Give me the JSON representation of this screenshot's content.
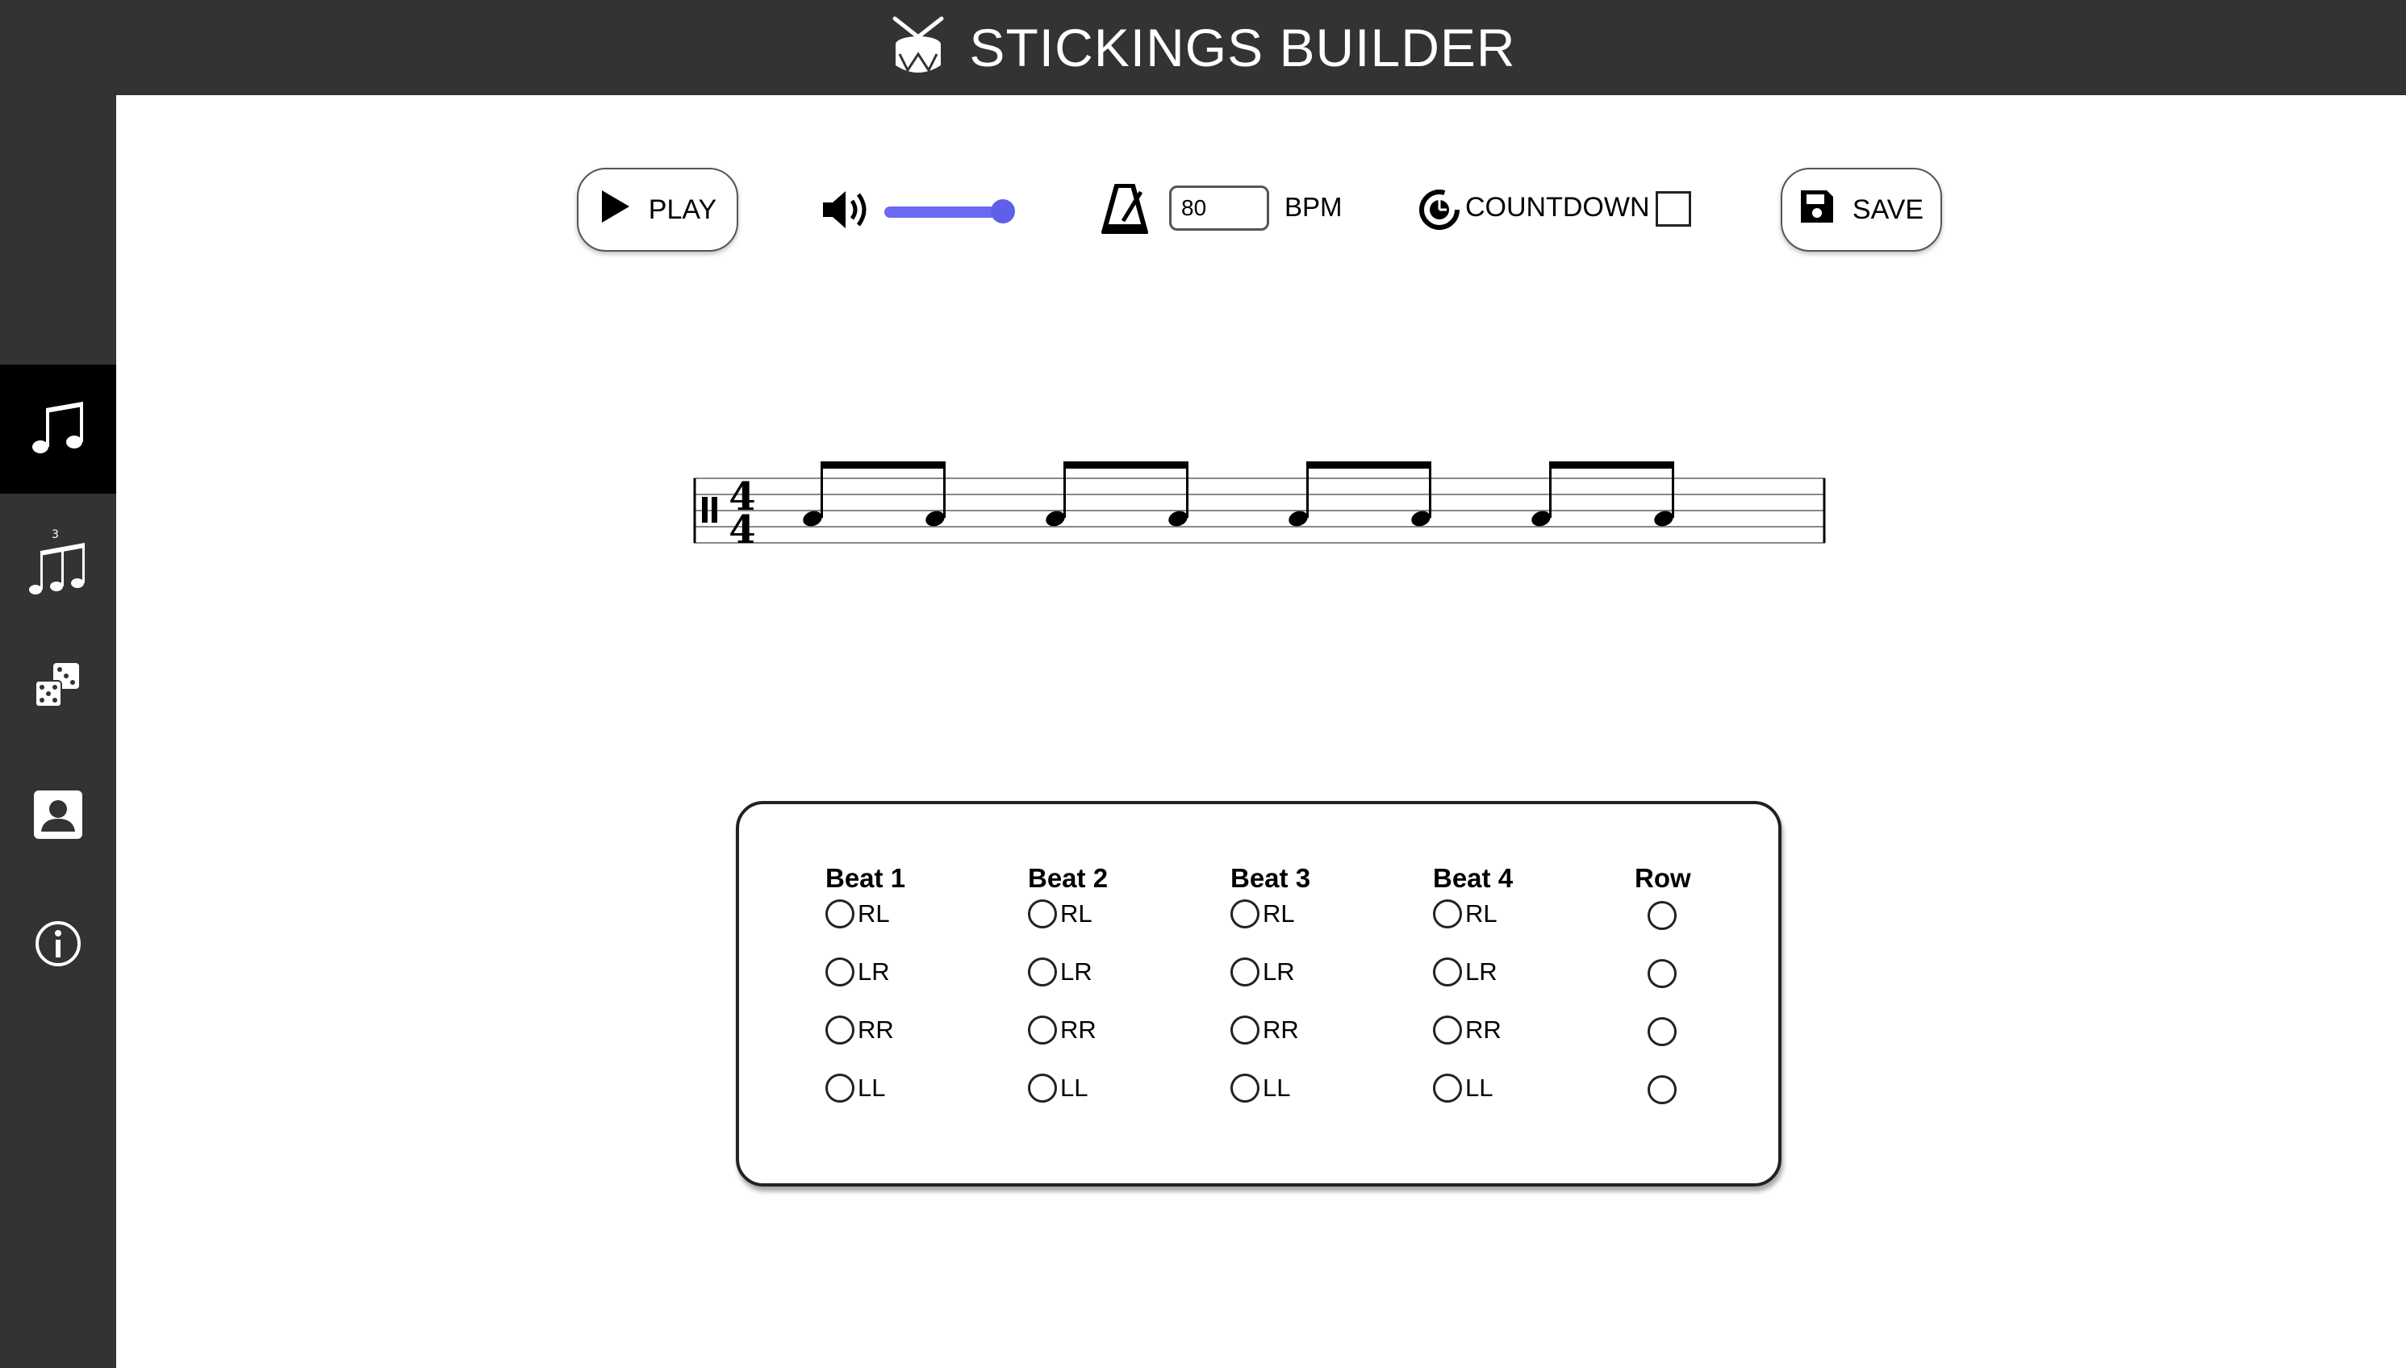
{
  "header": {
    "title": "STICKINGS BUILDER",
    "logo_icon": "drum-icon"
  },
  "sidebar": {
    "items": [
      {
        "icon": "music-note-icon",
        "active": true
      },
      {
        "icon": "triplet-notes-icon",
        "active": false
      },
      {
        "icon": "dice-icon",
        "active": false
      },
      {
        "icon": "contact-card-icon",
        "active": false
      },
      {
        "icon": "info-icon",
        "active": false
      }
    ]
  },
  "toolbar": {
    "play_label": "PLAY",
    "volume_level": 1.0,
    "bpm_value": "80",
    "bpm_label": "BPM",
    "countdown_label": "COUNTDOWN",
    "countdown_checked": false,
    "save_label": "SAVE",
    "accent_color": "#5f5fe8"
  },
  "notation": {
    "time_signature_top": "4",
    "time_signature_bottom": "4",
    "beats": 4,
    "notes_per_beat": 2
  },
  "stickings": {
    "columns": [
      {
        "header": "Beat 1",
        "options": [
          "RL",
          "LR",
          "RR",
          "LL"
        ]
      },
      {
        "header": "Beat 2",
        "options": [
          "RL",
          "LR",
          "RR",
          "LL"
        ]
      },
      {
        "header": "Beat 3",
        "options": [
          "RL",
          "LR",
          "RR",
          "LL"
        ]
      },
      {
        "header": "Beat 4",
        "options": [
          "RL",
          "LR",
          "RR",
          "LL"
        ]
      }
    ],
    "row_header": "Row",
    "row_count": 4
  }
}
